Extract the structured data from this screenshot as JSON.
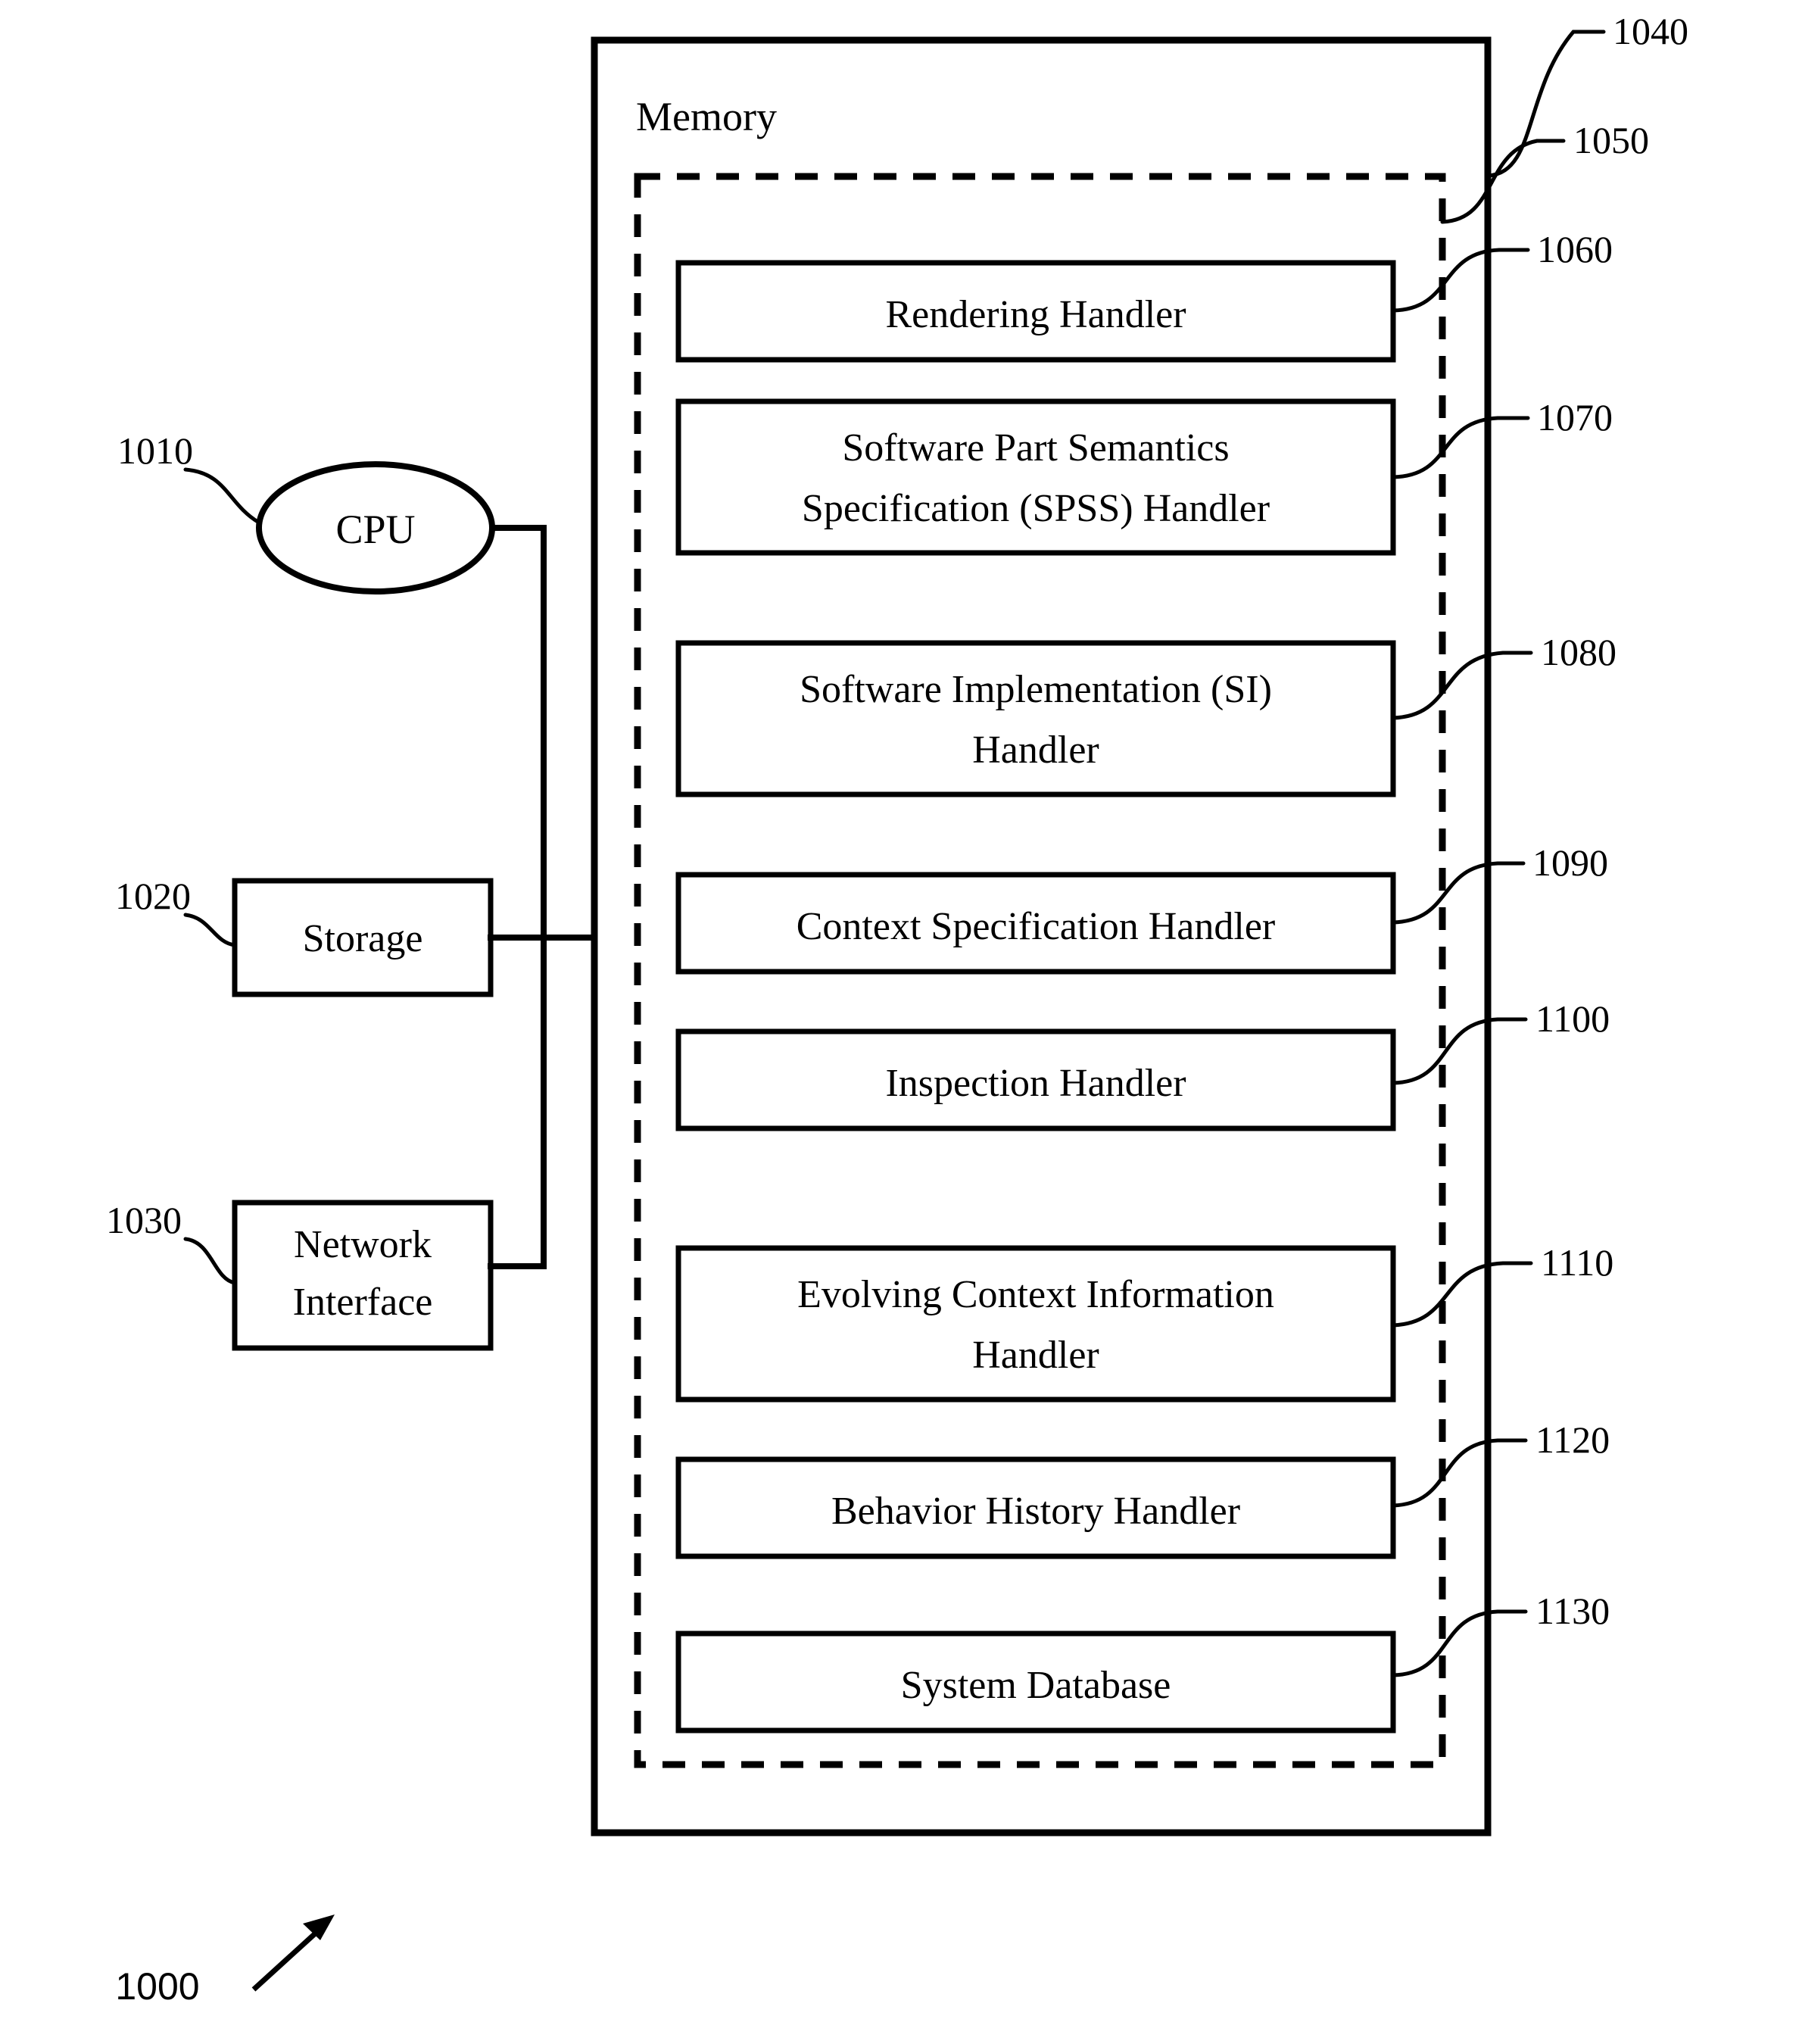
{
  "figure": {
    "figure_ref": "1000",
    "memory_title": "Memory"
  },
  "components": {
    "cpu": {
      "label": "CPU",
      "ref": "1010"
    },
    "storage": {
      "label": "Storage",
      "ref": "1020"
    },
    "network_interface": {
      "label_line1": "Network",
      "label_line2": "Interface",
      "ref": "1030"
    },
    "memory": {
      "label": "Memory",
      "ref": "1040"
    },
    "handler_group": {
      "ref": "1050"
    }
  },
  "handlers": [
    {
      "id": "rendering",
      "ref": "1060",
      "lines": [
        "Rendering Handler"
      ]
    },
    {
      "id": "spss",
      "ref": "1070",
      "lines": [
        "Software Part Semantics",
        "Specification (SPSS) Handler"
      ]
    },
    {
      "id": "si",
      "ref": "1080",
      "lines": [
        "Software Implementation (SI)",
        "Handler"
      ]
    },
    {
      "id": "context-spec",
      "ref": "1090",
      "lines": [
        "Context Specification Handler"
      ]
    },
    {
      "id": "inspection",
      "ref": "1100",
      "lines": [
        "Inspection Handler"
      ]
    },
    {
      "id": "evolving-context",
      "ref": "1110",
      "lines": [
        "Evolving Context Information",
        "Handler"
      ]
    },
    {
      "id": "behavior-history",
      "ref": "1120",
      "lines": [
        "Behavior History Handler"
      ]
    },
    {
      "id": "system-database",
      "ref": "1130",
      "lines": [
        "System Database"
      ]
    }
  ],
  "colors": {
    "stroke": "#000000",
    "background": "#ffffff"
  }
}
